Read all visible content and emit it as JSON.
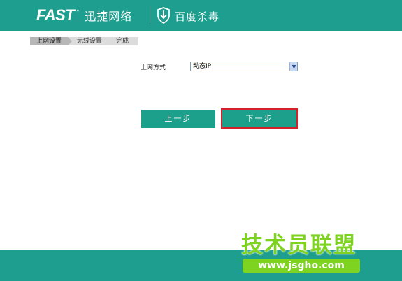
{
  "header": {
    "brand_en": "FAST",
    "brand_tm": "™",
    "brand_cn": "迅捷网络",
    "partner_name": "百度杀毒",
    "shield_icon": "baidu-shield-icon",
    "background_color": "#1e9e8e"
  },
  "steps": {
    "items": [
      {
        "label": "上网设置",
        "active": true
      },
      {
        "label": "无线设置",
        "active": false
      },
      {
        "label": "完成",
        "active": false
      }
    ]
  },
  "form": {
    "connection_type_label": "上网方式",
    "connection_type_value": "动态IP"
  },
  "buttons": {
    "prev_label": "上一步",
    "next_label": "下一步",
    "color": "#1c9f8b",
    "highlight_color": "#d3222c"
  },
  "watermark": {
    "text_cn": "技术员联盟",
    "url": "www.jsgho.com",
    "color": "#7ed321"
  }
}
